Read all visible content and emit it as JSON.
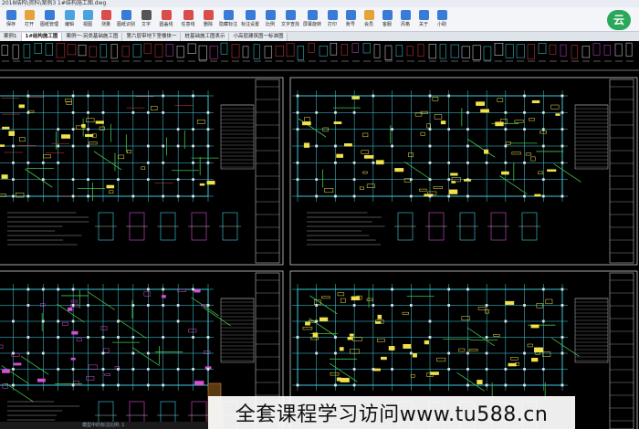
{
  "window": {
    "title": "2018结构\\资料\\案例3 1#结构施工图.dwg"
  },
  "toolbar": {
    "items": [
      {
        "label": "保存",
        "icon": "save-icon",
        "color": "#3b7bd8"
      },
      {
        "label": "打开",
        "icon": "open-icon",
        "color": "#e5a43a"
      },
      {
        "label": "图纸管理",
        "icon": "drawing-manager-icon",
        "color": "#3b7bd8"
      },
      {
        "label": "编辑",
        "icon": "edit-icon",
        "color": "#4aa3df"
      },
      {
        "label": "视图",
        "icon": "view-icon",
        "color": "#4aa3df"
      },
      {
        "label": "测量",
        "icon": "measure-icon",
        "color": "#d94d4d"
      },
      {
        "label": "图纸识别",
        "icon": "recognize-icon",
        "color": "#3b7bd8"
      },
      {
        "label": "文字",
        "icon": "text-icon",
        "color": "#555555"
      },
      {
        "label": "圆盖线",
        "icon": "cloud-line-icon",
        "color": "#d94d4d"
      },
      {
        "label": "任意线",
        "icon": "freehand-icon",
        "color": "#d94d4d"
      },
      {
        "label": "删除",
        "icon": "delete-icon",
        "color": "#d94d4d"
      },
      {
        "label": "隐藏标注",
        "icon": "hide-markup-icon",
        "color": "#3b7bd8"
      },
      {
        "label": "标注设置",
        "icon": "markup-settings-icon",
        "color": "#3b7bd8"
      },
      {
        "label": "比例",
        "icon": "scale-icon",
        "color": "#3b7bd8"
      },
      {
        "label": "文字查找",
        "icon": "text-search-icon",
        "color": "#3b7bd8"
      },
      {
        "label": "屏幕旋转",
        "icon": "rotate-icon",
        "color": "#3b7bd8"
      },
      {
        "label": "打印",
        "icon": "print-icon",
        "color": "#3b7bd8"
      },
      {
        "label": "账号",
        "icon": "account-icon",
        "color": "#3b7bd8"
      },
      {
        "label": "会员",
        "icon": "vip-icon",
        "color": "#e5a43a"
      },
      {
        "label": "客服",
        "icon": "support-icon",
        "color": "#3b7bd8"
      },
      {
        "label": "风格",
        "icon": "theme-icon",
        "color": "#3b7bd8"
      },
      {
        "label": "关于",
        "icon": "about-icon",
        "color": "#3b7bd8"
      },
      {
        "label": "小助",
        "icon": "assistant-icon",
        "color": "#3b7bd8"
      }
    ],
    "brand_text": "云"
  },
  "tabs": [
    {
      "label": "案例1"
    },
    {
      "label": "1#结构施工图",
      "active": true
    },
    {
      "label": "案例一-另类基础施工图"
    },
    {
      "label": "第六层带地下室楼体一"
    },
    {
      "label": "桩基础施工图表示"
    },
    {
      "label": "小高层建筑图一标准图"
    }
  ],
  "banner": {
    "text": "全套课程学习访问www.tu588.cn"
  },
  "status": {
    "text": "模型中的标注比例: 1"
  },
  "colors": {
    "cad_cyan": "#3fd6e8",
    "cad_yellow": "#f2e24a",
    "cad_white": "#e8e8e8",
    "cad_magenta": "#d64fd6",
    "cad_red": "#e04040",
    "cad_green": "#43c24a"
  }
}
